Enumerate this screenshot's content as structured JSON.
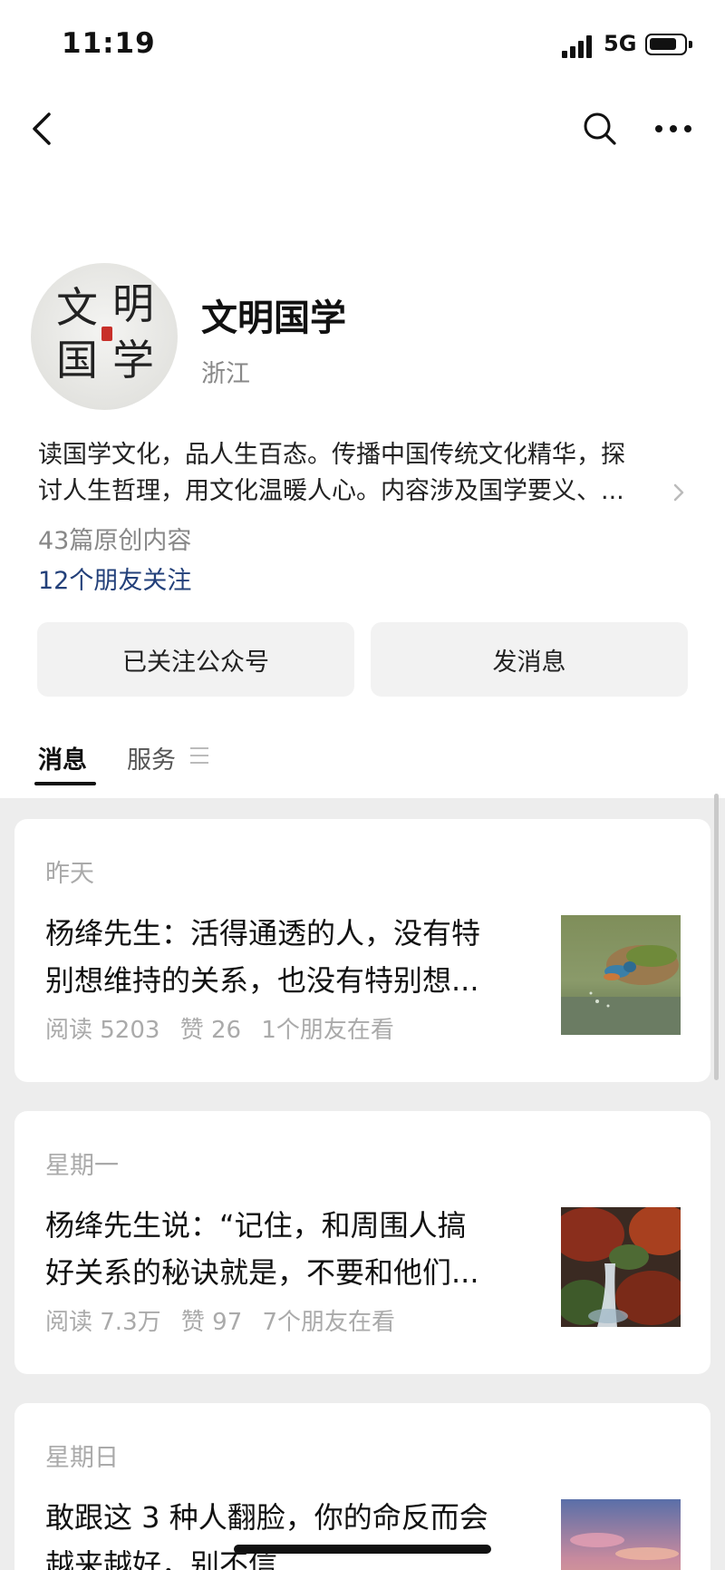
{
  "status_bar": {
    "time": "11:19",
    "network": "5G"
  },
  "account": {
    "name": "文明国学",
    "location": "浙江",
    "avatar_text": [
      "文",
      "明",
      "国",
      "学"
    ],
    "description_line1": "读国学文化，品人生百态。传播中国传统文化精华，探",
    "description_line2": "讨人生哲理，用文化温暖人心。内容涉及国学要义、...",
    "original_count": "43篇原创内容",
    "friends_following": "12个朋友关注"
  },
  "buttons": {
    "followed": "已关注公众号",
    "message": "发消息"
  },
  "tabs": {
    "messages": "消息",
    "services": "服务"
  },
  "articles": [
    {
      "date": "昨天",
      "title_line1": "杨绛先生：活得通透的人，没有特",
      "title_line2": "别想维持的关系，也没有特别想...",
      "reads": "阅读 5203",
      "likes": "赞 26",
      "friends": "1个朋友在看"
    },
    {
      "date": "星期一",
      "title_line1": "杨绛先生说：“记住，和周围人搞",
      "title_line2": "好关系的秘诀就是，不要和他们...",
      "reads": "阅读 7.3万",
      "likes": "赞 97",
      "friends": "7个朋友在看"
    },
    {
      "date": "星期日",
      "title_line1": "敢跟这 3 种人翻脸，你的命反而会",
      "title_line2": "越来越好，别不信"
    }
  ],
  "colors": {
    "link": "#23407a",
    "background": "#ededed",
    "card": "#ffffff",
    "button": "#f2f2f2"
  }
}
